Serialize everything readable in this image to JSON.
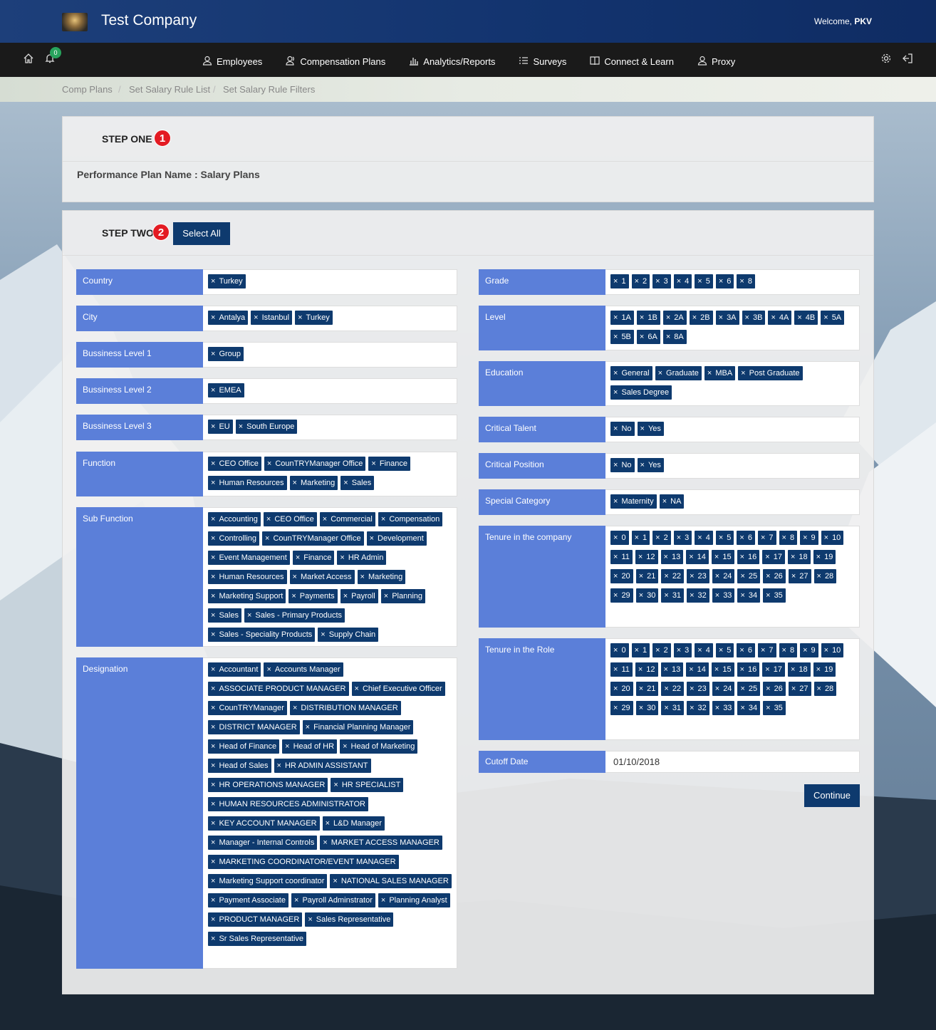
{
  "header": {
    "company": "Test Company",
    "welcome_prefix": "Welcome, ",
    "welcome_user": "PKV"
  },
  "nav": {
    "notification_count": "0",
    "items": [
      {
        "label": "Employees",
        "icon": "user-icon"
      },
      {
        "label": "Compensation Plans",
        "icon": "users-icon"
      },
      {
        "label": "Analytics/Reports",
        "icon": "bar-chart-icon"
      },
      {
        "label": "Surveys",
        "icon": "list-icon"
      },
      {
        "label": "Connect & Learn",
        "icon": "book-icon"
      },
      {
        "label": "Proxy",
        "icon": "user-icon"
      }
    ]
  },
  "breadcrumb": [
    "Comp Plans",
    "Set Salary Rule List",
    "Set Salary Rule Filters"
  ],
  "step_one": {
    "title": "STEP ONE",
    "badge": "1",
    "plan_name": "Performance Plan Name : Salary Plans"
  },
  "step_two": {
    "title": "STEP TWO",
    "badge": "2",
    "select_all": "Select All"
  },
  "left_filters": [
    {
      "label": "Country",
      "tags": [
        "Turkey"
      ]
    },
    {
      "label": "City",
      "tags": [
        "Antalya",
        "Istanbul",
        "Turkey"
      ]
    },
    {
      "label": "Bussiness Level 1",
      "tags": [
        "Group"
      ]
    },
    {
      "label": "Bussiness Level 2",
      "tags": [
        "EMEA"
      ]
    },
    {
      "label": "Bussiness Level 3",
      "tags": [
        "EU",
        "South Europe"
      ]
    },
    {
      "label": "Function",
      "tags": [
        "CEO Office",
        "CounTRYManager Office",
        "Finance",
        "Human Resources",
        "Marketing",
        "Sales"
      ]
    },
    {
      "label": "Sub Function",
      "tags": [
        "Accounting",
        "CEO Office",
        "Commercial",
        "Compensation",
        "Controlling",
        "CounTRYManager Office",
        "Development",
        "Event Management",
        "Finance",
        "HR Admin",
        "Human Resources",
        "Market Access",
        "Marketing",
        "Marketing Support",
        "Payments",
        "Payroll",
        "Planning",
        "Sales",
        "Sales - Primary Products",
        "Sales - Speciality Products",
        "Supply Chain"
      ]
    },
    {
      "label": "Designation",
      "tags": [
        "Accountant",
        "Accounts Manager",
        "ASSOCIATE PRODUCT MANAGER",
        "Chief Executive Officer",
        "CounTRYManager",
        "DISTRIBUTION MANAGER",
        "DISTRICT MANAGER",
        "Financial Planning Manager",
        "Head of Finance",
        "Head of HR",
        "Head of Marketing",
        "Head of Sales",
        "HR ADMIN ASSISTANT",
        "HR OPERATIONS MANAGER",
        "HR SPECIALIST",
        "HUMAN RESOURCES ADMINISTRATOR",
        "KEY ACCOUNT MANAGER",
        "L&D Manager",
        "Manager - Internal Controls",
        "MARKET ACCESS MANAGER",
        "MARKETING COORDINATOR/EVENT MANAGER",
        "Marketing Support coordinator",
        "NATIONAL SALES MANAGER",
        "Payment Associate",
        "Payroll Adminstrator",
        "Planning Analyst",
        "PRODUCT MANAGER",
        "Sales Representative",
        "Sr Sales Representative"
      ]
    }
  ],
  "right_filters": [
    {
      "label": "Grade",
      "tags": [
        "1",
        "2",
        "3",
        "4",
        "5",
        "6",
        "8"
      ]
    },
    {
      "label": "Level",
      "tags": [
        "1A",
        "1B",
        "2A",
        "2B",
        "3A",
        "3B",
        "4A",
        "4B",
        "5A",
        "5B",
        "6A",
        "8A"
      ]
    },
    {
      "label": "Education",
      "tags": [
        "General",
        "Graduate",
        "MBA",
        "Post Graduate",
        "Sales Degree"
      ]
    },
    {
      "label": "Critical Talent",
      "tags": [
        "No",
        "Yes"
      ]
    },
    {
      "label": "Critical Position",
      "tags": [
        "No",
        "Yes"
      ]
    },
    {
      "label": "Special Category",
      "tags": [
        "Maternity",
        "NA"
      ]
    },
    {
      "label": "Tenure in the company",
      "tags": [
        "0",
        "1",
        "2",
        "3",
        "4",
        "5",
        "6",
        "7",
        "8",
        "9",
        "10",
        "11",
        "12",
        "13",
        "14",
        "15",
        "16",
        "17",
        "18",
        "19",
        "20",
        "21",
        "22",
        "23",
        "24",
        "25",
        "26",
        "27",
        "28",
        "29",
        "30",
        "31",
        "32",
        "33",
        "34",
        "35"
      ]
    },
    {
      "label": "Tenure in the Role",
      "tags": [
        "0",
        "1",
        "2",
        "3",
        "4",
        "5",
        "6",
        "7",
        "8",
        "9",
        "10",
        "11",
        "12",
        "13",
        "14",
        "15",
        "16",
        "17",
        "18",
        "19",
        "20",
        "21",
        "22",
        "23",
        "24",
        "25",
        "26",
        "27",
        "28",
        "29",
        "30",
        "31",
        "32",
        "33",
        "34",
        "35"
      ]
    }
  ],
  "cutoff": {
    "label": "Cutoff Date",
    "value": "01/10/2018"
  },
  "continue_label": "Continue",
  "colors": {
    "label_bg": "#5b7fd9",
    "tag_bg": "#0e3a6e",
    "badge": "#e31b23",
    "notif": "#27a35c"
  }
}
